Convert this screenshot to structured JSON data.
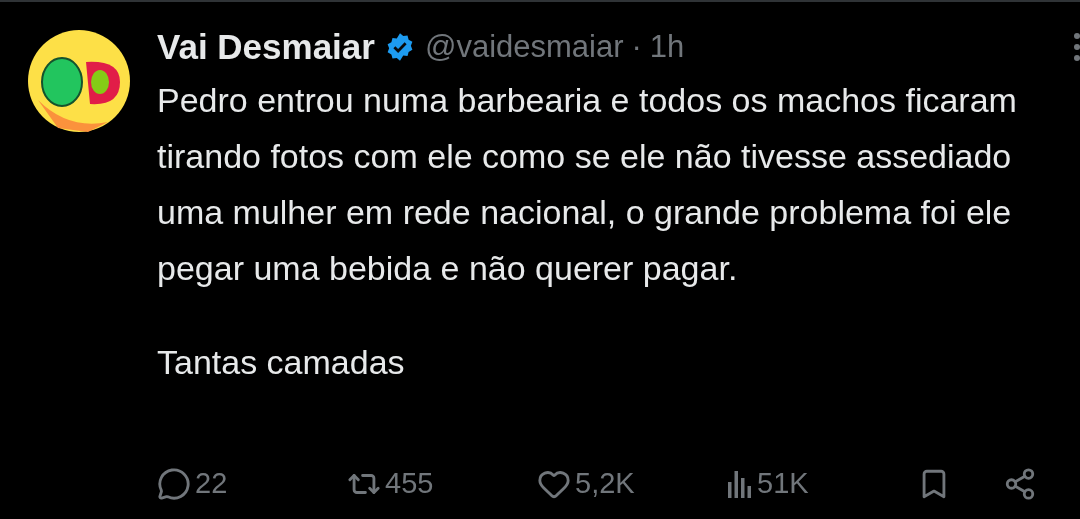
{
  "tweet": {
    "author": {
      "name": "Vai Desmaiar",
      "verified": true,
      "handle": "@vaidesmaiar",
      "separator": "·",
      "time": "1h"
    },
    "paragraphs": [
      "Pedro entrou numa barbearia e todos os machos ficaram tirando fotos com ele como se ele não tivesse assediado uma mulher em rede nacional, o grande problema foi ele pegar uma bebida e não querer pagar.",
      "Tantas camadas"
    ],
    "actions": [
      {
        "kind": "reply",
        "count": "22"
      },
      {
        "kind": "repost",
        "count": "455"
      },
      {
        "kind": "like",
        "count": "5,2K"
      },
      {
        "kind": "views",
        "count": "51K"
      },
      {
        "kind": "bookmark"
      },
      {
        "kind": "share"
      }
    ]
  }
}
